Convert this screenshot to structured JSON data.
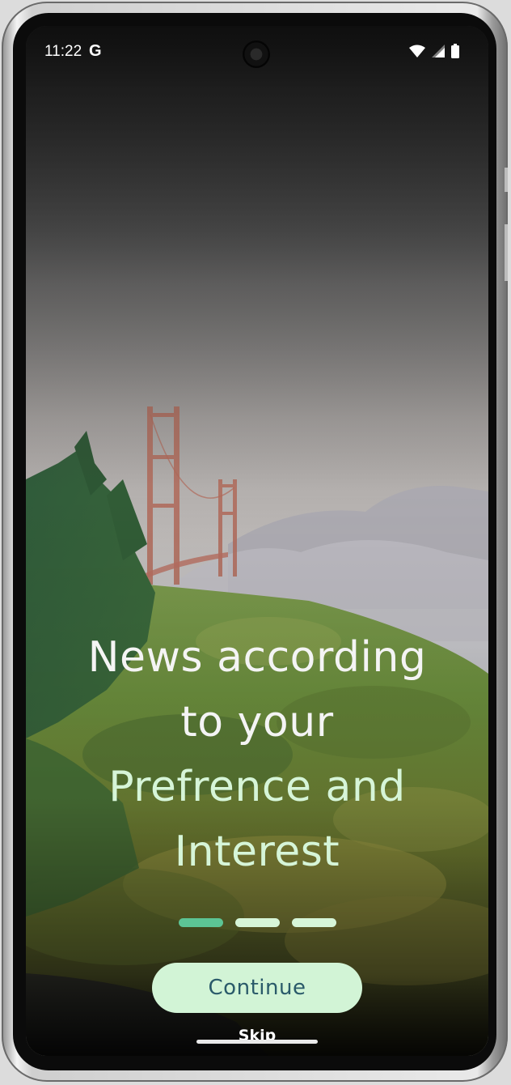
{
  "status_bar": {
    "time": "11:22",
    "google_badge": "G",
    "icons": [
      "wifi-icon",
      "cellular-signal-icon",
      "battery-icon"
    ]
  },
  "onboarding": {
    "headline_line1": "News according",
    "headline_line2": "to your",
    "headline_line3": "Prefrence and",
    "headline_line4": "Interest",
    "page_indicator": {
      "total": 3,
      "active_index": 0
    },
    "continue_label": "Continue",
    "skip_label": "Skip"
  },
  "colors": {
    "headline_white": "#f4f4f4",
    "headline_accent": "#d6f5d8",
    "button_bg": "#d2f4d6",
    "button_text": "#2a5a6a",
    "dot_active": "#5cc495",
    "dot_inactive": "#d6f5d8"
  }
}
